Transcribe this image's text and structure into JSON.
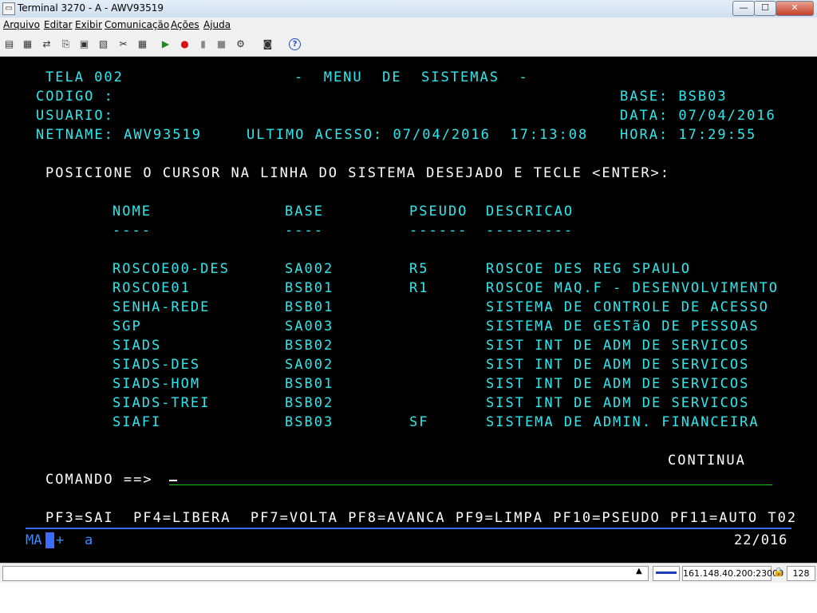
{
  "window": {
    "title": "Terminal 3270 - A - AWV93519",
    "controls": {
      "minimize": "—",
      "maximize": "☐",
      "close": "✕"
    }
  },
  "menu": [
    "Arquivo",
    "Editar",
    "Exibir",
    "Comunicação",
    "Ações",
    "Ajuda"
  ],
  "toolbar_icons": [
    "print-screen-icon",
    "print-icon",
    "send-file-icon",
    "copy-icon",
    "paste-icon",
    "copy-append-icon",
    "macro-icon",
    "keypad-icon",
    "play-icon",
    "record-icon",
    "pause-icon",
    "stop-icon",
    "settings-icon",
    "disk-icon",
    "help-icon"
  ],
  "terminal": {
    "header": {
      "tela": "TELA 002",
      "title": "-  MENU  DE  SISTEMAS  -",
      "codigo_label": "CODIGO :",
      "usuario_label": "USUARIO:",
      "netname": "NETNAME: AWV93519",
      "ultimo_acesso": "ULTIMO ACESSO: 07/04/2016  17:13:08",
      "base": "BASE: BSB03",
      "data": "DATA: 07/04/2016",
      "hora": "HORA: 17:29:55"
    },
    "instruction": "POSICIONE O CURSOR NA LINHA DO SISTEMA DESEJADO E TECLE <ENTER>:",
    "columns": {
      "nome": "NOME",
      "nome_ul": "----",
      "base": "BASE",
      "base_ul": "----",
      "pseudo": "PSEUDO",
      "pseudo_ul": "------",
      "descricao": "DESCRICAO",
      "descricao_ul": "---------"
    },
    "rows": [
      {
        "nome": "ROSCOE00-DES",
        "base": "SA002",
        "pseudo": "R5",
        "descricao": "ROSCOE DES REG SPAULO"
      },
      {
        "nome": "ROSCOE01",
        "base": "BSB01",
        "pseudo": "R1",
        "descricao": "ROSCOE MAQ.F - DESENVOLVIMENTO"
      },
      {
        "nome": "SENHA-REDE",
        "base": "BSB01",
        "pseudo": "",
        "descricao": "SISTEMA DE CONTROLE DE ACESSO"
      },
      {
        "nome": "SGP",
        "base": "SA003",
        "pseudo": "",
        "descricao": "SISTEMA DE GESTãO DE PESSOAS"
      },
      {
        "nome": "SIADS",
        "base": "BSB02",
        "pseudo": "",
        "descricao": "SIST INT DE ADM DE SERVICOS"
      },
      {
        "nome": "SIADS-DES",
        "base": "SA002",
        "pseudo": "",
        "descricao": "SIST INT DE ADM DE SERVICOS"
      },
      {
        "nome": "SIADS-HOM",
        "base": "BSB01",
        "pseudo": "",
        "descricao": "SIST INT DE ADM DE SERVICOS"
      },
      {
        "nome": "SIADS-TREI",
        "base": "BSB02",
        "pseudo": "",
        "descricao": "SIST INT DE ADM DE SERVICOS"
      },
      {
        "nome": "SIAFI",
        "base": "BSB03",
        "pseudo": "SF",
        "descricao": "SISTEMA DE ADMIN. FINANCEIRA"
      }
    ],
    "continua": "CONTINUA",
    "comando_label": "COMANDO ==>",
    "comando_value": "",
    "pf_keys": "PF3=SAI  PF4=LIBERA  PF7=VOLTA PF8=AVANCA PF9=LIMPA PF10=PSEUDO PF11=AUTO T02",
    "oia": {
      "mode": "MA",
      "plus": "+",
      "indicator": "a",
      "cursor_pos": "22/016"
    }
  },
  "statusbar": {
    "address": "161.148.40.200:23000",
    "count": "128"
  }
}
